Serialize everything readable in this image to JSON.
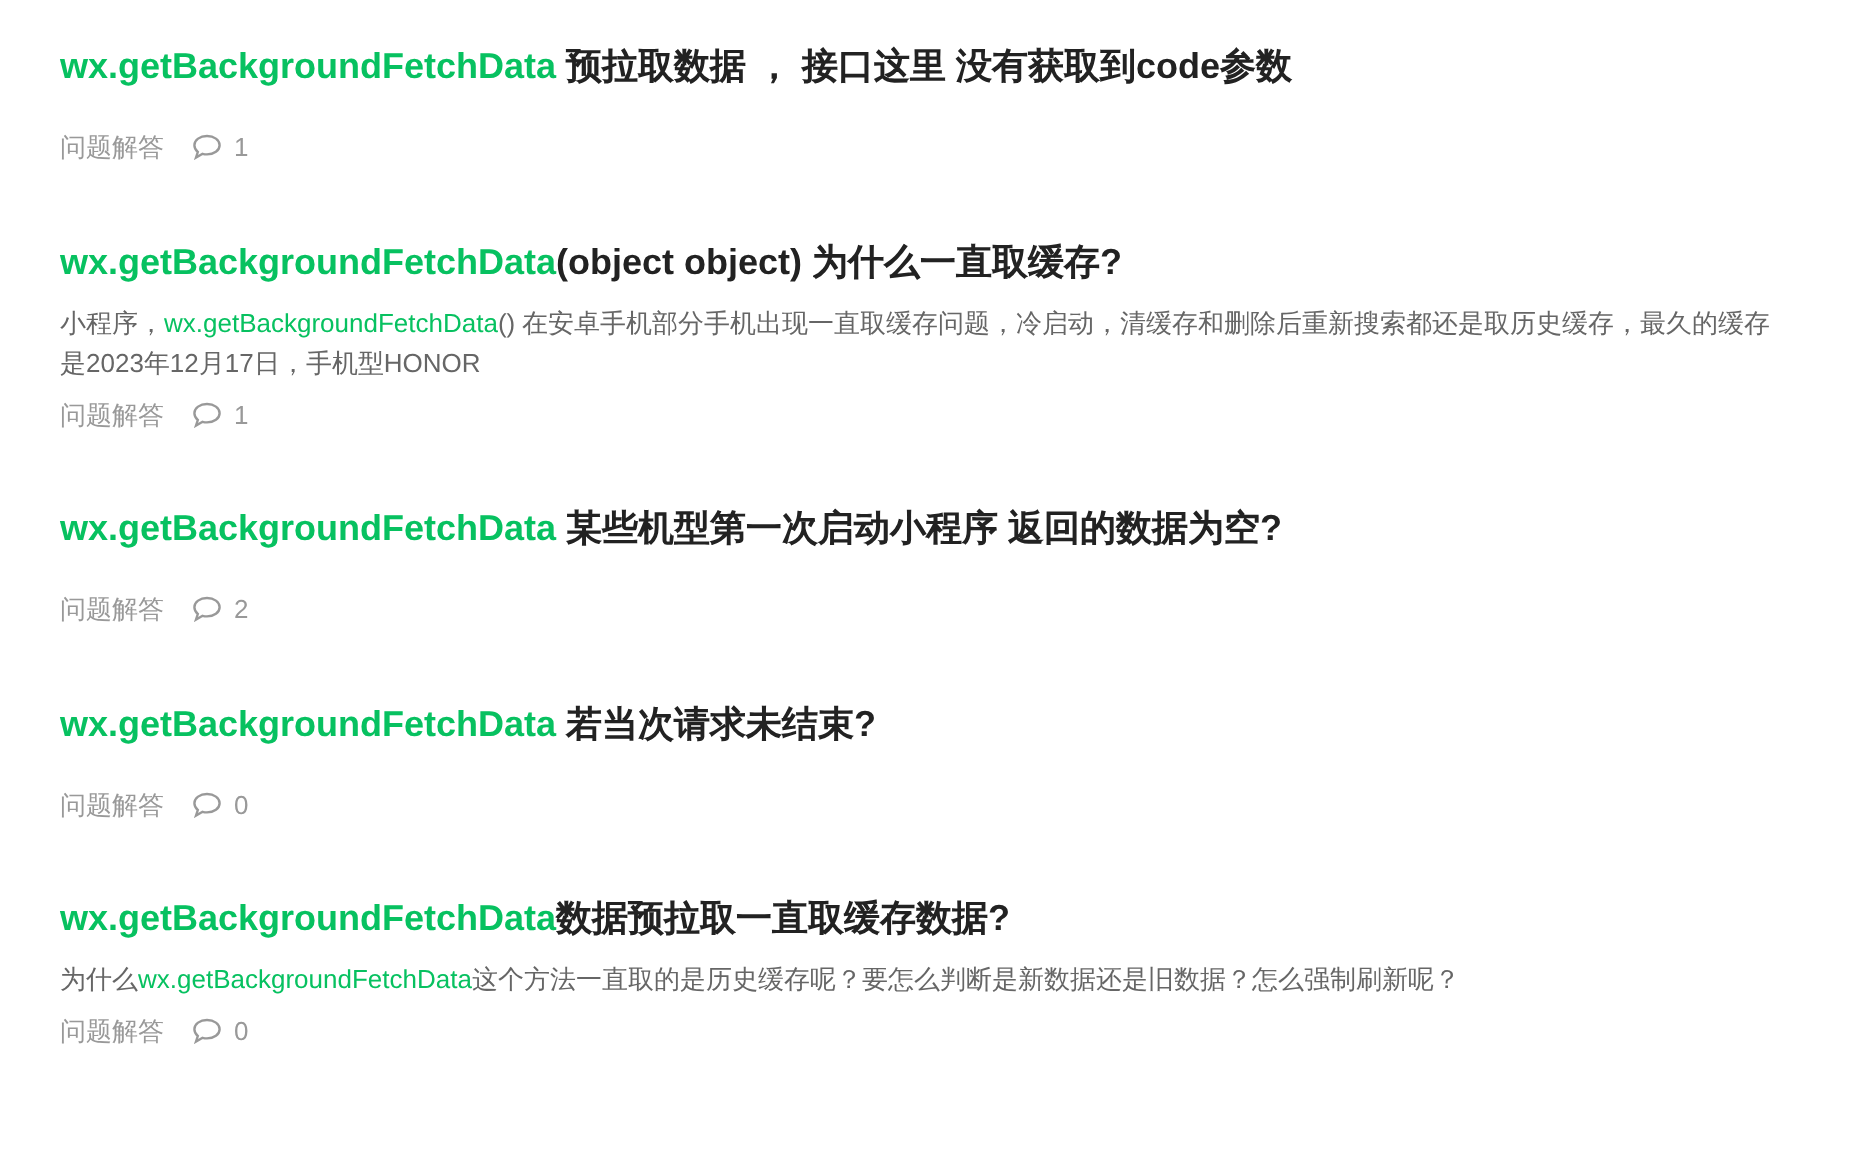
{
  "posts": [
    {
      "title_keyword": "wx.getBackgroundFetchData",
      "title_rest": " 预拉取数据 ， 接口这里 没有获取到code参数",
      "category": "问题解答",
      "comments": "1"
    },
    {
      "title_keyword": "wx.getBackgroundFetchData",
      "title_rest": "(object object) 为什么一直取缓存?",
      "excerpt": {
        "before": "小程序，",
        "keyword": "wx.getBackgroundFetchData",
        "after": "() 在安卓手机部分手机出现一直取缓存问题，冷启动，清缓存和删除后重新搜索都还是取历史缓存，最久的缓存是2023年12月17日，手机型HONOR"
      },
      "category": "问题解答",
      "comments": "1"
    },
    {
      "title_keyword": "wx.getBackgroundFetchData",
      "title_rest": " 某些机型第一次启动小程序 返回的数据为空?",
      "category": "问题解答",
      "comments": "2"
    },
    {
      "title_keyword": "wx.getBackgroundFetchData",
      "title_rest": " 若当次请求未结束?",
      "category": "问题解答",
      "comments": "0"
    },
    {
      "title_keyword": "wx.getBackgroundFetchData",
      "title_rest": "数据预拉取一直取缓存数据?",
      "excerpt": {
        "before": "为什么",
        "keyword": "wx.getBackgroundFetchData",
        "after": "这个方法一直取的是历史缓存呢？要怎么判断是新数据还是旧数据？怎么强制刷新呢？"
      },
      "category": "问题解答",
      "comments": "0"
    }
  ]
}
